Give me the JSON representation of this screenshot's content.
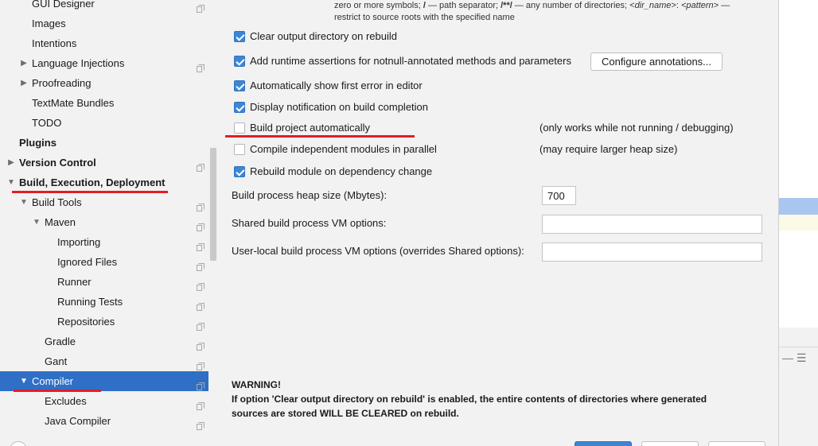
{
  "sidebar": {
    "items": [
      {
        "label": "GUI Designer",
        "indent": 1,
        "arrow": "",
        "bold": false,
        "copy": true
      },
      {
        "label": "Images",
        "indent": 1,
        "arrow": "",
        "bold": false,
        "copy": false
      },
      {
        "label": "Intentions",
        "indent": 1,
        "arrow": "",
        "bold": false,
        "copy": false
      },
      {
        "label": "Language Injections",
        "indent": 1,
        "arrow": "right",
        "bold": false,
        "copy": true
      },
      {
        "label": "Proofreading",
        "indent": 1,
        "arrow": "right",
        "bold": false,
        "copy": false
      },
      {
        "label": "TextMate Bundles",
        "indent": 1,
        "arrow": "",
        "bold": false,
        "copy": false
      },
      {
        "label": "TODO",
        "indent": 1,
        "arrow": "",
        "bold": false,
        "copy": false
      },
      {
        "label": "Plugins",
        "indent": 0,
        "arrow": "",
        "bold": true,
        "copy": false
      },
      {
        "label": "Version Control",
        "indent": 0,
        "arrow": "right",
        "bold": true,
        "copy": true
      },
      {
        "label": "Build, Execution, Deployment",
        "indent": 0,
        "arrow": "down",
        "bold": true,
        "copy": false
      },
      {
        "label": "Build Tools",
        "indent": 1,
        "arrow": "down",
        "bold": false,
        "copy": true
      },
      {
        "label": "Maven",
        "indent": 2,
        "arrow": "down",
        "bold": false,
        "copy": true
      },
      {
        "label": "Importing",
        "indent": 3,
        "arrow": "",
        "bold": false,
        "copy": true
      },
      {
        "label": "Ignored Files",
        "indent": 3,
        "arrow": "",
        "bold": false,
        "copy": true
      },
      {
        "label": "Runner",
        "indent": 3,
        "arrow": "",
        "bold": false,
        "copy": true
      },
      {
        "label": "Running Tests",
        "indent": 3,
        "arrow": "",
        "bold": false,
        "copy": true
      },
      {
        "label": "Repositories",
        "indent": 3,
        "arrow": "",
        "bold": false,
        "copy": true
      },
      {
        "label": "Gradle",
        "indent": 2,
        "arrow": "",
        "bold": false,
        "copy": true
      },
      {
        "label": "Gant",
        "indent": 2,
        "arrow": "",
        "bold": false,
        "copy": true
      },
      {
        "label": "Compiler",
        "indent": 1,
        "arrow": "down",
        "bold": false,
        "copy": true,
        "selected": true
      },
      {
        "label": "Excludes",
        "indent": 2,
        "arrow": "",
        "bold": false,
        "copy": true
      },
      {
        "label": "Java Compiler",
        "indent": 2,
        "arrow": "",
        "bold": false,
        "copy": true
      }
    ]
  },
  "main": {
    "top_desc": {
      "line1_a": "zero or more symbols; ",
      "line1_b": "/",
      "line1_c": " — path separator; ",
      "line1_d": "/**/",
      "line1_e": " — any number of directories; ",
      "line1_f": "<dir_name>",
      "line1_g": ":",
      "line1_h": "<pattern>",
      "line1_i": " —",
      "line2": "restrict to source roots with the specified name"
    },
    "options": [
      {
        "label": "Clear output directory on rebuild",
        "checked": true,
        "note": ""
      },
      {
        "label": "Add runtime assertions for notnull-annotated methods and parameters",
        "checked": true,
        "note": ""
      },
      {
        "label": "Automatically show first error in editor",
        "checked": true,
        "note": ""
      },
      {
        "label": "Display notification on build completion",
        "checked": true,
        "note": ""
      },
      {
        "label": "Build project automatically",
        "checked": false,
        "note": "(only works while not running / debugging)"
      },
      {
        "label": "Compile independent modules in parallel",
        "checked": false,
        "note": "(may require larger heap size)"
      },
      {
        "label": "Rebuild module on dependency change",
        "checked": true,
        "note": ""
      }
    ],
    "configure_button": "Configure annotations...",
    "heap_label": "Build process heap size (Mbytes):",
    "heap_value": "700",
    "shared_vm_label": "Shared build process VM options:",
    "shared_vm_value": "",
    "user_vm_label": "User-local build process VM options (overrides Shared options):",
    "user_vm_value": "",
    "warning_title": "WARNING!",
    "warning_line1": "If option 'Clear output directory on rebuild' is enabled, the entire contents of directories where generated",
    "warning_line2": "sources are stored WILL BE CLEARED on rebuild."
  },
  "right_panel": {
    "tool_icons": "—  ☰"
  },
  "colors": {
    "accent": "#2f6fc6",
    "checkbox": "#3d86d6",
    "annotation_red": "#e51c23",
    "panel_bg": "#f2f2f2"
  }
}
